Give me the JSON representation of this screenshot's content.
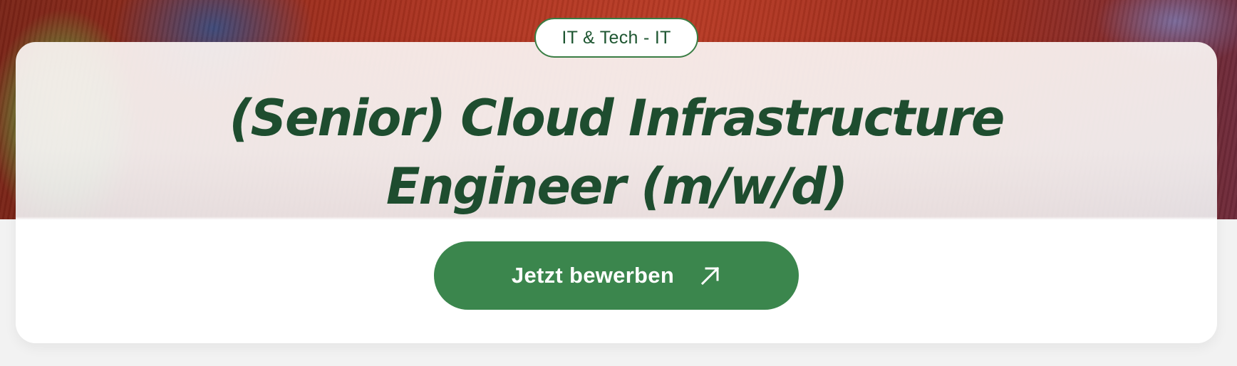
{
  "job": {
    "category": "IT & Tech - IT",
    "title_line1": "(Senior) Cloud Infrastructure",
    "title_line2": "Engineer (m/w/d)"
  },
  "actions": {
    "apply_label": "Jetzt bewerben",
    "apply_icon": "arrow-up-right-icon"
  },
  "colors": {
    "brand_green": "#3b864d",
    "title_green": "#1e4d2f",
    "pill_text": "#1e5631"
  }
}
